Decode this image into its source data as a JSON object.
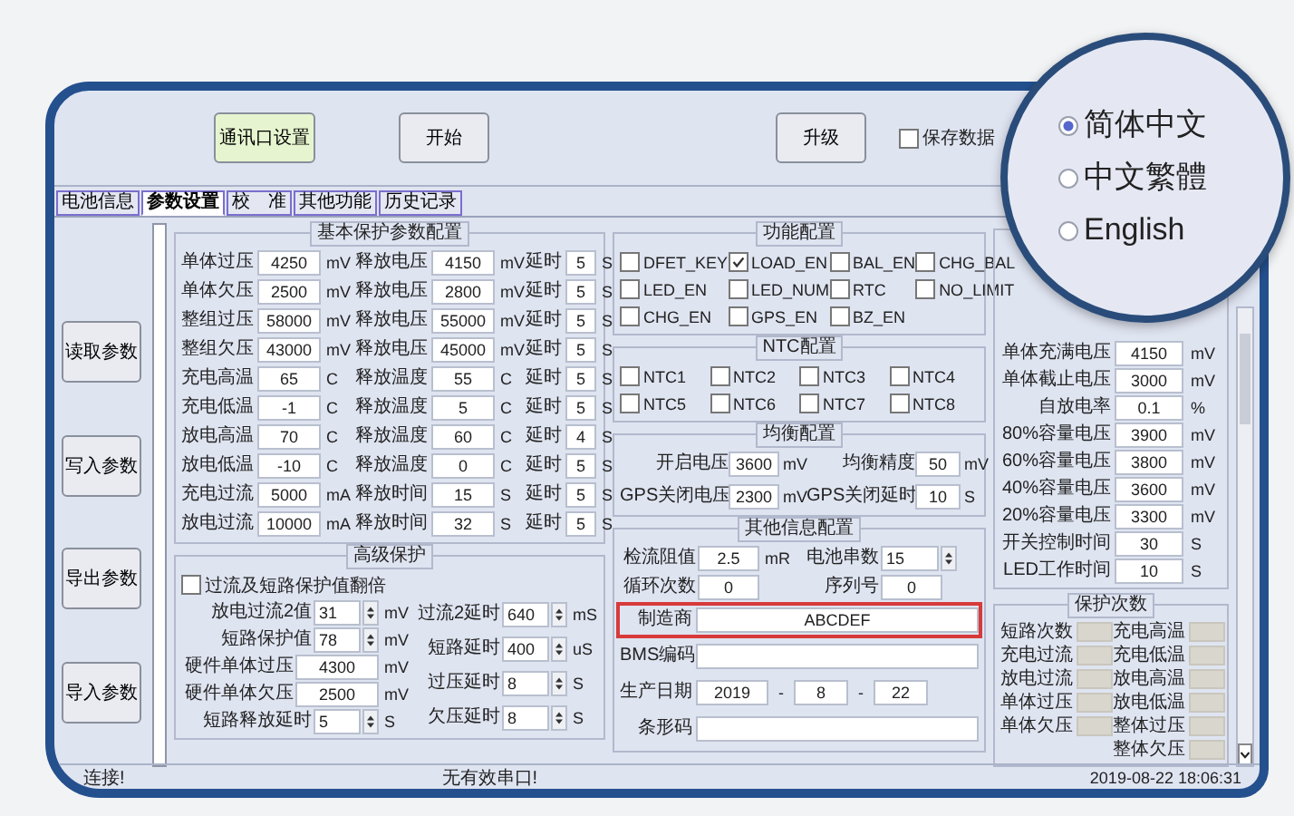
{
  "toolbar": {
    "comm_button": {
      "label": "通讯口设置"
    },
    "start_button": {
      "label": "开始"
    },
    "upgrade_button": {
      "label": "升级"
    },
    "save_data": {
      "label": "保存数据",
      "checked": false
    }
  },
  "language": {
    "options": [
      {
        "label": "简体中文",
        "selected": true
      },
      {
        "label": "中文繁體",
        "selected": false
      },
      {
        "label": "English",
        "selected": false
      }
    ]
  },
  "tabs": [
    {
      "label": "电池信息",
      "selected": false
    },
    {
      "label": "参数设置",
      "selected": true
    },
    {
      "label": "校　准",
      "selected": false
    },
    {
      "label": "其他功能",
      "selected": false
    },
    {
      "label": "历史记录",
      "selected": false
    }
  ],
  "side_buttons": [
    "读取参数",
    "写入参数",
    "导出参数",
    "导入参数"
  ],
  "basic_protection": {
    "title": "基本保护参数配置",
    "rows": [
      {
        "label": "单体过压",
        "value": "4250",
        "unit": "mV",
        "release_label": "释放电压",
        "release_value": "4150",
        "release_unit": "mV",
        "delay_label": "延时",
        "delay_value": "5",
        "delay_unit": "S"
      },
      {
        "label": "单体欠压",
        "value": "2500",
        "unit": "mV",
        "release_label": "释放电压",
        "release_value": "2800",
        "release_unit": "mV",
        "delay_label": "延时",
        "delay_value": "5",
        "delay_unit": "S"
      },
      {
        "label": "整组过压",
        "value": "58000",
        "unit": "mV",
        "release_label": "释放电压",
        "release_value": "55000",
        "release_unit": "mV",
        "delay_label": "延时",
        "delay_value": "5",
        "delay_unit": "S"
      },
      {
        "label": "整组欠压",
        "value": "43000",
        "unit": "mV",
        "release_label": "释放电压",
        "release_value": "45000",
        "release_unit": "mV",
        "delay_label": "延时",
        "delay_value": "5",
        "delay_unit": "S"
      },
      {
        "label": "充电高温",
        "value": "65",
        "unit": "C",
        "release_label": "释放温度",
        "release_value": "55",
        "release_unit": "C",
        "delay_label": "延时",
        "delay_value": "5",
        "delay_unit": "S"
      },
      {
        "label": "充电低温",
        "value": "-1",
        "unit": "C",
        "release_label": "释放温度",
        "release_value": "5",
        "release_unit": "C",
        "delay_label": "延时",
        "delay_value": "5",
        "delay_unit": "S"
      },
      {
        "label": "放电高温",
        "value": "70",
        "unit": "C",
        "release_label": "释放温度",
        "release_value": "60",
        "release_unit": "C",
        "delay_label": "延时",
        "delay_value": "4",
        "delay_unit": "S"
      },
      {
        "label": "放电低温",
        "value": "-10",
        "unit": "C",
        "release_label": "释放温度",
        "release_value": "0",
        "release_unit": "C",
        "delay_label": "延时",
        "delay_value": "5",
        "delay_unit": "S"
      },
      {
        "label": "充电过流",
        "value": "5000",
        "unit": "mA",
        "release_label": "释放时间",
        "release_value": "15",
        "release_unit": "S",
        "delay_label": "延时",
        "delay_value": "5",
        "delay_unit": "S"
      },
      {
        "label": "放电过流",
        "value": "10000",
        "unit": "mA",
        "release_label": "释放时间",
        "release_value": "32",
        "release_unit": "S",
        "delay_label": "延时",
        "delay_value": "5",
        "delay_unit": "S"
      }
    ]
  },
  "functions": {
    "title": "功能配置",
    "items": [
      {
        "label": "DFET_KEY",
        "checked": false
      },
      {
        "label": "LOAD_EN",
        "checked": true
      },
      {
        "label": "BAL_EN",
        "checked": false
      },
      {
        "label": "CHG_BAL",
        "checked": false
      },
      {
        "label": "LED_EN",
        "checked": false
      },
      {
        "label": "LED_NUM",
        "checked": false
      },
      {
        "label": "RTC",
        "checked": false
      },
      {
        "label": "NO_LIMIT",
        "checked": false
      },
      {
        "label": "CHG_EN",
        "checked": false
      },
      {
        "label": "GPS_EN",
        "checked": false
      },
      {
        "label": "BZ_EN",
        "checked": false
      }
    ]
  },
  "ntc": {
    "title": "NTC配置",
    "items": [
      {
        "label": "NTC1",
        "checked": false
      },
      {
        "label": "NTC2",
        "checked": false
      },
      {
        "label": "NTC3",
        "checked": false
      },
      {
        "label": "NTC4",
        "checked": false
      },
      {
        "label": "NTC5",
        "checked": false
      },
      {
        "label": "NTC6",
        "checked": false
      },
      {
        "label": "NTC7",
        "checked": false
      },
      {
        "label": "NTC8",
        "checked": false
      }
    ]
  },
  "balance": {
    "title": "均衡配置",
    "fields": [
      {
        "label": "开启电压",
        "value": "3600",
        "unit": "mV"
      },
      {
        "label": "均衡精度",
        "value": "50",
        "unit": "mV"
      },
      {
        "label": "GPS关闭电压",
        "value": "2300",
        "unit": "mV"
      },
      {
        "label": "GPS关闭延时",
        "value": "10",
        "unit": "S"
      }
    ]
  },
  "right_params": {
    "rows": [
      {
        "label": "单体充满电压",
        "value": "4150",
        "unit": "mV"
      },
      {
        "label": "单体截止电压",
        "value": "3000",
        "unit": "mV"
      },
      {
        "label": "自放电率",
        "value": "0.1",
        "unit": "%"
      },
      {
        "label": "80%容量电压",
        "value": "3900",
        "unit": "mV"
      },
      {
        "label": "60%容量电压",
        "value": "3800",
        "unit": "mV"
      },
      {
        "label": "40%容量电压",
        "value": "3600",
        "unit": "mV"
      },
      {
        "label": "20%容量电压",
        "value": "3300",
        "unit": "mV"
      },
      {
        "label": "开关控制时间",
        "value": "30",
        "unit": "S"
      },
      {
        "label": "LED工作时间",
        "value": "10",
        "unit": "S"
      }
    ]
  },
  "advanced": {
    "title": "高级保护",
    "double_option": {
      "label": "过流及短路保护值翻倍",
      "checked": false
    },
    "left_fields": [
      {
        "label": "放电过流2值",
        "value": "31",
        "unit": "mV",
        "kind": "spin"
      },
      {
        "label": "短路保护值",
        "value": "78",
        "unit": "mV",
        "kind": "spin"
      },
      {
        "label": "硬件单体过压",
        "value": "4300",
        "unit": "mV",
        "kind": "text"
      },
      {
        "label": "硬件单体欠压",
        "value": "2500",
        "unit": "mV",
        "kind": "text"
      },
      {
        "label": "短路释放延时",
        "value": "5",
        "unit": "S",
        "kind": "spin"
      }
    ],
    "right_fields": [
      {
        "label": "过流2延时",
        "value": "640",
        "unit": "mS",
        "kind": "spin"
      },
      {
        "label": "短路延时",
        "value": "400",
        "unit": "uS",
        "kind": "spin"
      },
      {
        "label": "过压延时",
        "value": "8",
        "unit": "S",
        "kind": "spin"
      },
      {
        "label": "欠压延时",
        "value": "8",
        "unit": "S",
        "kind": "spin"
      }
    ]
  },
  "other_info": {
    "title": "其他信息配置",
    "fields": [
      {
        "label": "检流阻值",
        "value": "2.5",
        "unit": "mR",
        "kind": "text"
      },
      {
        "label": "电池串数",
        "value": "15",
        "kind": "spin"
      },
      {
        "label": "循环次数",
        "value": "0",
        "kind": "text"
      },
      {
        "label": "序列号",
        "value": "0",
        "kind": "text"
      }
    ],
    "manufacturer": {
      "label": "制造商",
      "value": "ABCDEF",
      "highlighted": true
    },
    "bms_code": {
      "label": "BMS编码"
    },
    "production_date": {
      "label": "生产日期",
      "year": "2019",
      "month": "8",
      "day": "22",
      "separators": [
        "-",
        "-"
      ]
    },
    "barcode": {
      "label": "条形码"
    }
  },
  "protection_counts": {
    "title": "保护次数",
    "left": [
      "短路次数",
      "充电过流",
      "放电过流",
      "单体过压",
      "单体欠压"
    ],
    "right": [
      "充电高温",
      "充电低温",
      "放电高温",
      "放电低温",
      "整体过压",
      "整体欠压"
    ]
  },
  "status_bar": {
    "connection": "连接!",
    "port": "无有效串口!",
    "time": "2019-08-22 18:06:31"
  }
}
